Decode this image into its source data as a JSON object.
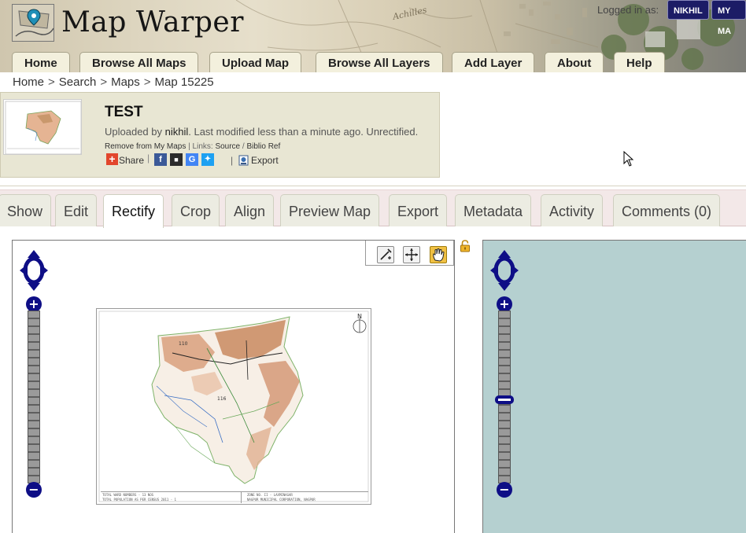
{
  "header": {
    "site_title": "Map Warper",
    "logged_in_label": "Logged in as:",
    "user_button": "NIKHIL",
    "my_maps_button": "MY MA"
  },
  "nav": {
    "tabs": [
      {
        "label": "Home"
      },
      {
        "label": "Browse All Maps"
      },
      {
        "label": "Upload Map"
      },
      {
        "label": "Browse All Layers"
      },
      {
        "label": "Add Layer"
      },
      {
        "label": "About"
      },
      {
        "label": "Help"
      }
    ]
  },
  "breadcrumb": {
    "items": [
      "Home",
      "Search",
      "Maps",
      "Map 15225"
    ],
    "separator": ">"
  },
  "map_info": {
    "title": "TEST",
    "uploaded_prefix": "Uploaded by ",
    "uploader": "nikhil",
    "uploaded_suffix": ". Last modified less than a minute ago. Unrectified.",
    "remove_link": "Remove from My Maps",
    "links_label": "Links:",
    "source_link": "Source",
    "biblio_link": "Biblio Ref",
    "link_sep": "/",
    "share_label": "Share",
    "export_label": "Export"
  },
  "action_tabs": {
    "active": "Rectify",
    "tabs": [
      {
        "label": "Show"
      },
      {
        "label": "Edit"
      },
      {
        "label": "Rectify"
      },
      {
        "label": "Crop"
      },
      {
        "label": "Align"
      },
      {
        "label": "Preview Map"
      },
      {
        "label": "Export"
      },
      {
        "label": "Metadata"
      },
      {
        "label": "Activity"
      },
      {
        "label": "Comments (0)"
      }
    ]
  },
  "map_panel": {
    "tools": [
      "add-control-point-icon",
      "move-control-point-icon",
      "pan-hand-icon"
    ],
    "active_tool": "pan-hand-icon",
    "north_label": "N",
    "map_label_a": "110",
    "map_label_b": "116",
    "footer_left_1": "TOTAL WARD NUMBERS - 13 NOS",
    "footer_left_2": "TOTAL POPULATION AS PER CENSUS 2011 - 1",
    "footer_right_1": "ZONE NO. II - LAXMINAGAR",
    "footer_right_2": "NAGPUR MUNICIPAL CORPORATION, NAGPUR"
  },
  "colors": {
    "nav_tab_bg": "#f3f0dd",
    "user_button_bg": "#1c1c66",
    "zoom_blue": "#0e0e86",
    "right_map_bg": "#b5d0d0",
    "active_tool": "#f0c043",
    "info_box_bg": "#e8e6d3"
  }
}
